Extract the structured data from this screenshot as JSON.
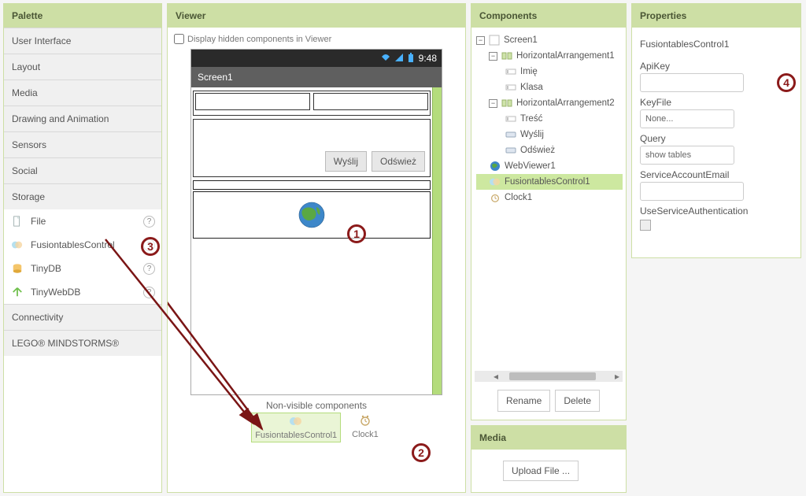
{
  "palette": {
    "title": "Palette",
    "categories": [
      "User Interface",
      "Layout",
      "Media",
      "Drawing and Animation",
      "Sensors",
      "Social",
      "Storage",
      "Connectivity",
      "LEGO® MINDSTORMS®"
    ],
    "storage_items": [
      {
        "label": "File",
        "icon": "file"
      },
      {
        "label": "FusiontablesControl",
        "icon": "fusion"
      },
      {
        "label": "TinyDB",
        "icon": "db"
      },
      {
        "label": "TinyWebDB",
        "icon": "webdb"
      }
    ]
  },
  "viewer": {
    "title": "Viewer",
    "hidden_label": "Display hidden components in Viewer",
    "status_time": "9:48",
    "screen_title": "Screen1",
    "btn_send": "Wyślij",
    "btn_refresh": "Odśwież",
    "nonvis_title": "Non-visible components",
    "nonvis": [
      {
        "label": "FusiontablesControl1",
        "icon": "fusion"
      },
      {
        "label": "Clock1",
        "icon": "clock"
      }
    ]
  },
  "components": {
    "title": "Components",
    "tree": {
      "root": "Screen1",
      "ha1": "HorizontalArrangement1",
      "imie": "Imię",
      "klasa": "Klasa",
      "ha2": "HorizontalArrangement2",
      "tresc": "Treść",
      "wyslij": "Wyślij",
      "odswiez": "Odśwież",
      "webviewer": "WebViewer1",
      "fusion": "FusiontablesControl1",
      "clock": "Clock1"
    },
    "rename": "Rename",
    "delete": "Delete"
  },
  "media": {
    "title": "Media",
    "upload": "Upload File ..."
  },
  "properties": {
    "title": "Properties",
    "component": "FusiontablesControl1",
    "apikey_label": "ApiKey",
    "apikey_value": "",
    "keyfile_label": "KeyFile",
    "keyfile_value": "None...",
    "query_label": "Query",
    "query_value": "show tables",
    "sae_label": "ServiceAccountEmail",
    "sae_value": "",
    "usa_label": "UseServiceAuthentication"
  },
  "annotations": {
    "a1": "1",
    "a2": "2",
    "a3": "3",
    "a4": "4"
  }
}
